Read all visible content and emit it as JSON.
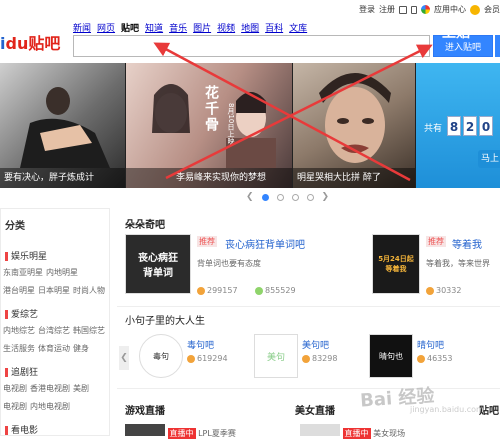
{
  "header": {
    "top_links": {
      "login": "登录",
      "register": "注册",
      "app_center": "应用中心",
      "vip": "会员"
    },
    "logo": {
      "left_text": "i",
      "pawn_text": "du",
      "brand_text": "贴吧"
    },
    "tabs": [
      "新闻",
      "网页",
      "贴吧",
      "知道",
      "音乐",
      "图片",
      "视频",
      "地图",
      "百科",
      "文库"
    ],
    "active_tab": "贴吧",
    "search": {
      "value": "",
      "placeholder": ""
    },
    "enter_button": "进入贴吧"
  },
  "banner": {
    "slides": [
      {
        "caption": "要有决心，胖子炼成计"
      },
      {
        "caption": "李易峰来实现你的梦想"
      },
      {
        "caption": "明星哭相大比拼 醉了"
      },
      {
        "caption": ""
      }
    ],
    "slide2_overlay": "花千骨",
    "slide2_sub": "8月10日上映",
    "ad": {
      "title": "上贴",
      "gong": "共有",
      "digits": [
        "8",
        "2",
        "0"
      ],
      "button": "马上"
    },
    "dot_count": 5,
    "active_dot": 0
  },
  "sidebar": {
    "heading": "分类",
    "sections": [
      {
        "title": "娱乐明星",
        "links": [
          [
            "东南亚明星",
            "内地明星"
          ],
          [
            "港台明星",
            "日本明星",
            "时尚人物"
          ]
        ]
      },
      {
        "title": "爱综艺",
        "links": [
          [
            "内地综艺",
            "台湾综艺",
            "韩国综艺"
          ],
          [
            "生活服务",
            "体育运动",
            "健身"
          ]
        ]
      },
      {
        "title": "追剧狂",
        "links": [
          [
            "电视剧",
            "香港电视剧",
            "美剧"
          ],
          [
            "电视剧",
            "内地电视剧"
          ]
        ]
      },
      {
        "title": "看电影",
        "links": []
      }
    ]
  },
  "main": {
    "duoduo": {
      "title": "朵朵奇吧",
      "cards": [
        {
          "thumb": "丧心病狂\n背单词",
          "tag": "推荐",
          "title": "丧心病狂背单词吧",
          "desc": "背单词也要有态度",
          "members": "299157",
          "posts": "855529"
        },
        {
          "thumb": "5月24日起\n等着我",
          "tag": "推荐",
          "title": "等着我",
          "desc": "等着我，等来世界",
          "members": "30332",
          "posts": ""
        }
      ]
    },
    "sentence": {
      "title": "小句子里的大人生",
      "items": [
        {
          "thumb": "毒句",
          "name": "毒句吧",
          "count": "619294"
        },
        {
          "thumb": "美句",
          "name": "美句吧",
          "count": "83298"
        },
        {
          "thumb": "晴句也",
          "name": "晴句吧",
          "count": "46353"
        }
      ]
    },
    "live_game": {
      "title": "游戏直播",
      "badge": "直播中",
      "lpl": "LPL夏季赛"
    },
    "live_beauty": {
      "title": "美女直播",
      "badge": "直播中",
      "text": "美女现场"
    },
    "tieba_label": "贴吧"
  },
  "watermark": {
    "text": "Bai 经验",
    "sub": "jingyan.baidu.com"
  },
  "colors": {
    "brand_blue": "#3385ff",
    "logo_red": "#e1251b",
    "x_red": "#e83a3a"
  }
}
